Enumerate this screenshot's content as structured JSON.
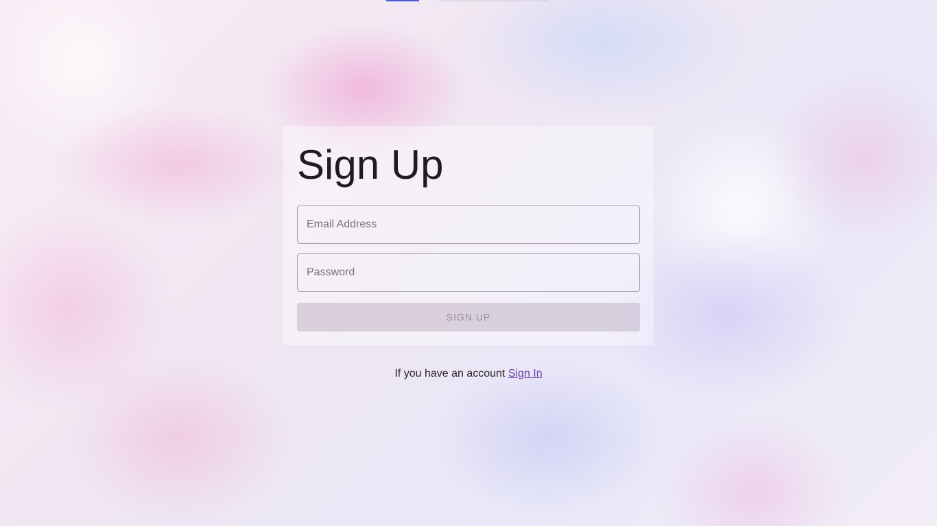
{
  "signup": {
    "title": "Sign Up",
    "email_placeholder": "Email Address",
    "password_placeholder": "Password",
    "submit_label": "SIGN UP"
  },
  "footer": {
    "prompt": "If you have an account",
    "signin_label": "Sign In"
  },
  "colors": {
    "link": "#6a3fa8",
    "title_text": "#1f1a24"
  }
}
